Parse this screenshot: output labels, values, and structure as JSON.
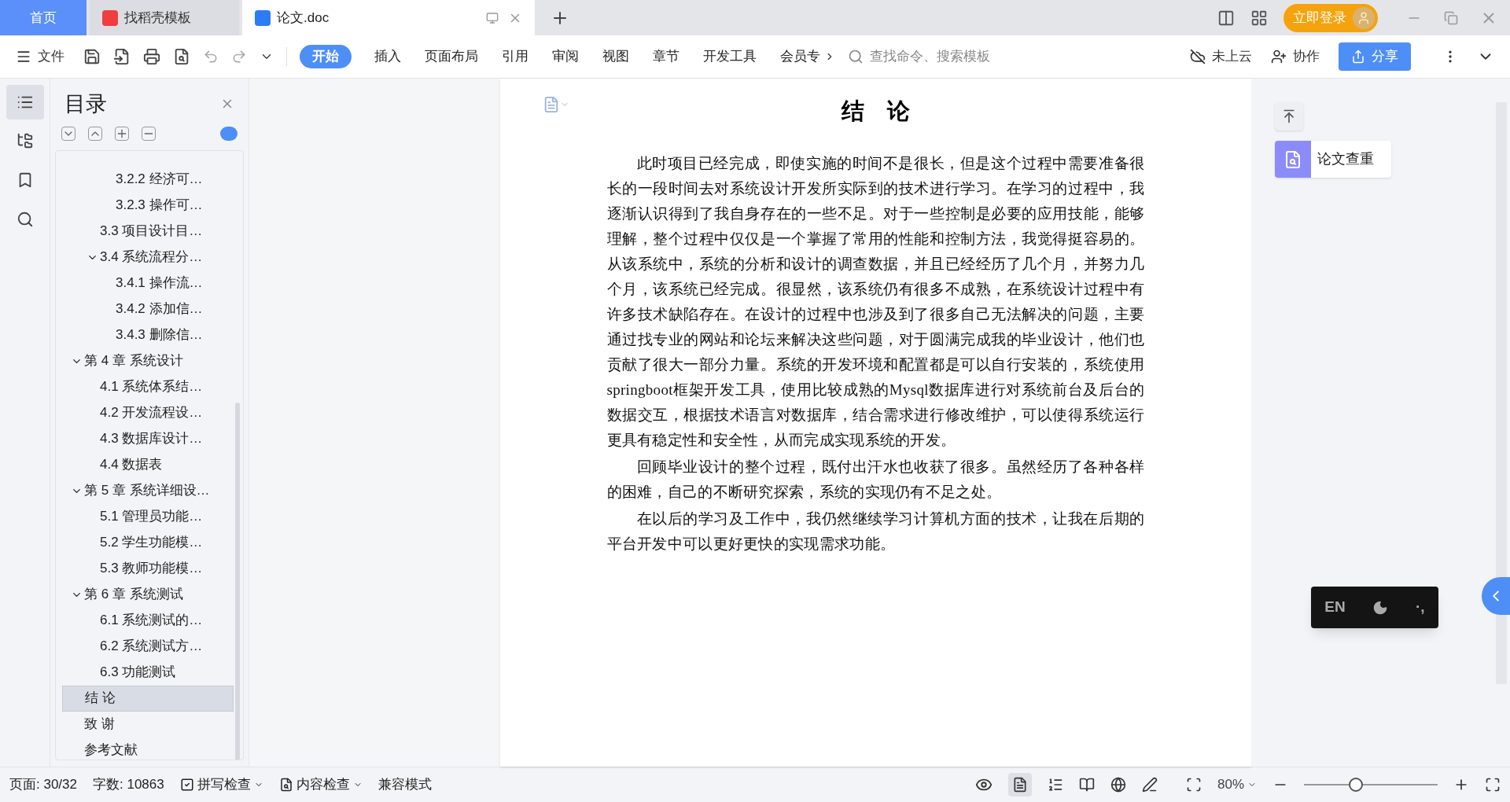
{
  "tabs": [
    {
      "kind": "home",
      "label": "首页",
      "selected": false
    },
    {
      "kind": "app",
      "label": "找稻壳模板",
      "selected": false
    },
    {
      "kind": "doc",
      "label": "论文.doc",
      "selected": true
    }
  ],
  "login": {
    "label": "立即登录"
  },
  "toolbar": {
    "file_menu": "文件",
    "ribbon_tabs": [
      {
        "label": "开始",
        "selected": true
      },
      {
        "label": "插入",
        "selected": false
      },
      {
        "label": "页面布局",
        "selected": false
      },
      {
        "label": "引用",
        "selected": false
      },
      {
        "label": "审阅",
        "selected": false
      },
      {
        "label": "视图",
        "selected": false
      },
      {
        "label": "章节",
        "selected": false
      },
      {
        "label": "开发工具",
        "selected": false
      },
      {
        "label": "会员专",
        "selected": false
      }
    ],
    "search": {
      "placeholder": "查找命令、搜索模板"
    },
    "cloud": "未上云",
    "collab": "协作",
    "share": "分享"
  },
  "toc": {
    "title": "目录",
    "continued": {
      "children": [
        {
          "children": [
            {
              "label": "3.2.2 经济可…",
              "selected": false
            },
            {
              "label": "3.2.3 操作可…",
              "selected": false
            }
          ]
        },
        {
          "label": "3.3  项目设计目…",
          "selected": false
        },
        {
          "label": "3.4 系统流程分…",
          "selected": false,
          "expanded": true,
          "children": [
            {
              "label": "3.4.1 操作流…",
              "selected": false
            },
            {
              "label": "3.4.2 添加信…",
              "selected": false
            },
            {
              "label": "3.4.3 删除信…",
              "selected": false
            }
          ]
        }
      ]
    },
    "items": [
      {
        "label": "第 4 章  系统设计",
        "selected": false,
        "expanded": true,
        "children": [
          {
            "label": "4.1  系统体系结…",
            "selected": false
          },
          {
            "label": "4.2 开发流程设…",
            "selected": false
          },
          {
            "label": "4.3  数据库设计…",
            "selected": false
          },
          {
            "label": "4.4  数据表",
            "selected": false
          }
        ]
      },
      {
        "label": "第 5 章  系统详细设…",
        "selected": false,
        "expanded": true,
        "children": [
          {
            "label": "5.1 管理员功能…",
            "selected": false
          },
          {
            "label": "5.2 学生功能模…",
            "selected": false
          },
          {
            "label": "5.3 教师功能模…",
            "selected": false
          }
        ]
      },
      {
        "label": "第 6 章   系统测试",
        "selected": false,
        "expanded": true,
        "children": [
          {
            "label": "6.1 系统测试的…",
            "selected": false
          },
          {
            "label": "6.2 系统测试方…",
            "selected": false
          },
          {
            "label": "6.3 功能测试",
            "selected": false
          }
        ]
      },
      {
        "label": "结    论",
        "selected": true
      },
      {
        "label": "致    谢",
        "selected": false
      },
      {
        "label": "参考文献",
        "selected": false
      }
    ]
  },
  "document": {
    "title": "结    论",
    "paragraphs": [
      "此时项目已经完成，即使实施的时间不是很长，但是这个过程中需要准备很长的一段时间去对系统设计开发所实际到的技术进行学习。在学习的过程中，我逐渐认识得到了我自身存在的一些不足。对于一些控制是必要的应用技能，能够理解，整个过程中仅仅是一个掌握了常用的性能和控制方法，我觉得挺容易的。从该系统中，系统的分析和设计的调查数据，并且已经经历了几个月，并努力几个月，该系统已经完成。很显然，该系统仍有很多不成熟，在系统设计过程中有许多技术缺陷存在。在设计的过程中也涉及到了很多自己无法解决的问题，主要通过找专业的网站和论坛来解决这些问题，对于圆满完成我的毕业设计，他们也贡献了很大一部分力量。系统的开发环境和配置都是可以自行安装的，系统使用springboot框架开发工具，使用比较成熟的Mysql数据库进行对系统前台及后台的数据交互，根据技术语言对数据库，结合需求进行修改维护，可以使得系统运行更具有稳定性和安全性，从而完成实现系统的开发。",
      "回顾毕业设计的整个过程，既付出汗水也收获了很多。虽然经历了各种各样的困难，自己的不断研究探索，系统的实现仍有不足之处。",
      "在以后的学习及工作中，我仍然继续学习计算机方面的技术，让我在后期的平台开发中可以更好更快的实现需求功能。"
    ]
  },
  "side_panel": {
    "check_button": "论文查重"
  },
  "ime_bar": {
    "mode": "EN",
    "punctuation": "·,"
  },
  "status_bar": {
    "page": "页面: 30/32",
    "words": "字数: 10863",
    "spell_check": "拼写检查",
    "content_check": "内容检查",
    "compat": "兼容模式",
    "zoom": "80%",
    "zoom_slider": {
      "level": 0.38
    }
  }
}
